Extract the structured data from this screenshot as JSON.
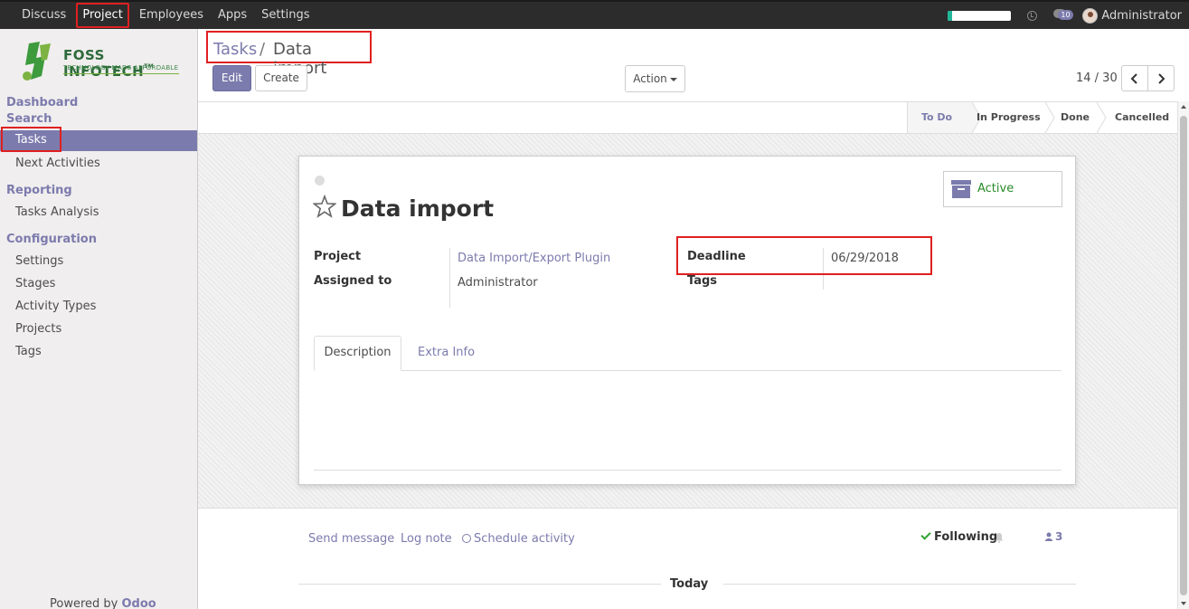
{
  "topbar": {
    "menu": [
      "Discuss",
      "Project",
      "Employees",
      "Apps",
      "Settings"
    ],
    "active_menu": "Project",
    "progress_fraction": 0.06,
    "message_count": "10",
    "user_name": "Administrator"
  },
  "logo": {
    "brand": "FOSS INFOTECH",
    "trademark": "TM",
    "tagline": "TECHNOLOGY MADE AFFORDABLE"
  },
  "sidebar": {
    "dashboard": "Dashboard",
    "search": "Search",
    "tasks": "Tasks",
    "next_activities": "Next Activities",
    "reporting": "Reporting",
    "tasks_analysis": "Tasks Analysis",
    "configuration": "Configuration",
    "settings": "Settings",
    "stages": "Stages",
    "activity_types": "Activity Types",
    "projects": "Projects",
    "tags": "Tags",
    "powered_by": "Powered by",
    "powered_brand": "Odoo"
  },
  "control": {
    "breadcrumb_link": "Tasks",
    "breadcrumb_sep": "/",
    "breadcrumb_current": "Data import",
    "edit_label": "Edit",
    "create_label": "Create",
    "action_label": "Action",
    "pager_value": "14 / 30"
  },
  "stages": [
    "To Do",
    "In Progress",
    "Done",
    "Cancelled"
  ],
  "current_stage": "To Do",
  "form": {
    "title": "Data import",
    "active_label": "Active",
    "project_label": "Project",
    "project_value": "Data Import/Export Plugin",
    "assigned_label": "Assigned to",
    "assigned_value": "Administrator",
    "deadline_label": "Deadline",
    "deadline_value": "06/29/2018",
    "tags_label": "Tags",
    "tab_description": "Description",
    "tab_extra": "Extra Info"
  },
  "chatter": {
    "send_message": "Send message",
    "log_note": "Log note",
    "schedule_activity": "Schedule activity",
    "following": "Following",
    "followers_count": "3",
    "today": "Today"
  },
  "colors": {
    "primary": "#7c7bad",
    "topbar": "#2c2c2c",
    "highlight_box": "#e02020",
    "active_green": "#2a8b2a"
  }
}
